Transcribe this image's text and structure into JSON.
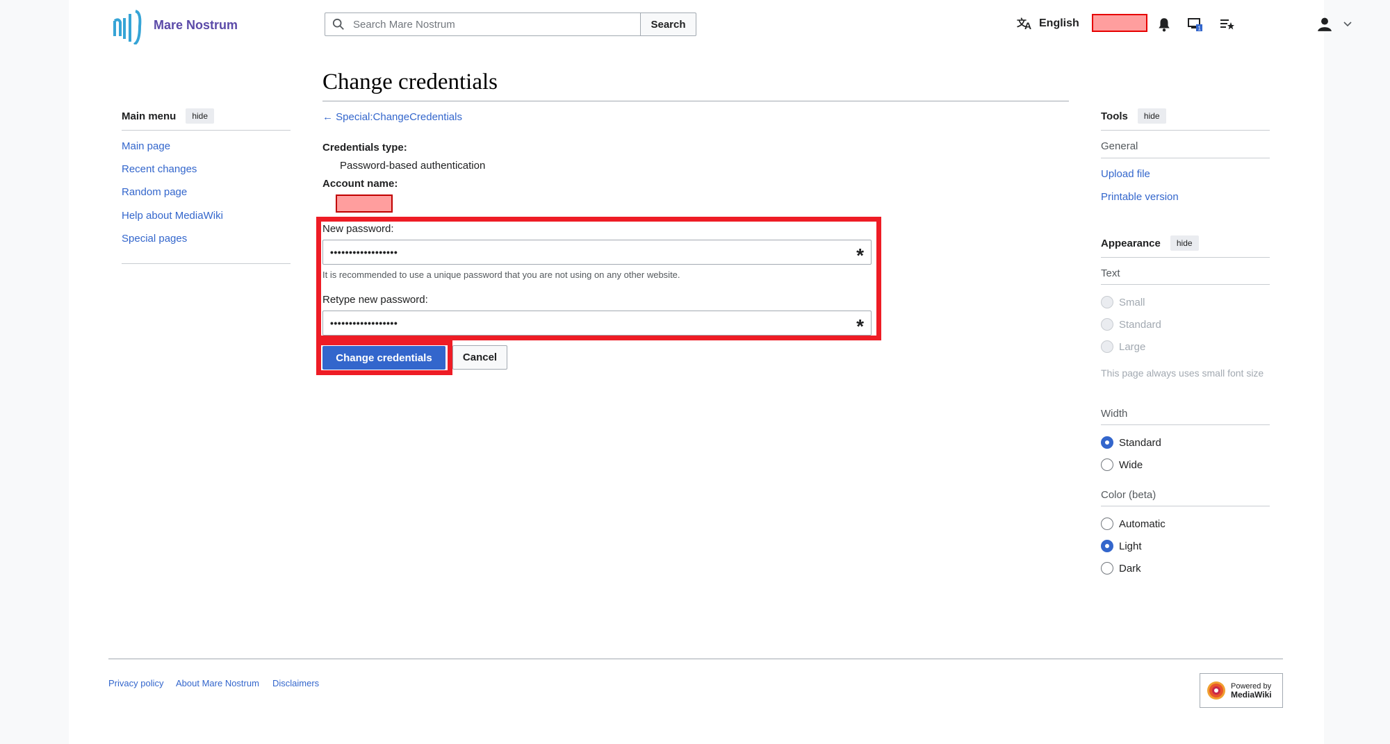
{
  "header": {
    "site_name": "Mare Nostrum",
    "search_placeholder": "Search Mare Nostrum",
    "search_button": "Search",
    "language": "English"
  },
  "main_menu": {
    "title": "Main menu",
    "hide_label": "hide",
    "items": [
      "Main page",
      "Recent changes",
      "Random page",
      "Help about MediaWiki",
      "Special pages"
    ]
  },
  "content": {
    "title": "Change credentials",
    "back_link": "← Special:ChangeCredentials",
    "credentials_type_label": "Credentials type:",
    "credentials_type_value": "Password-based authentication",
    "account_name_label": "Account name:",
    "new_password_label": "New password:",
    "new_password_value": "••••••••••••••••••",
    "password_hint": "It is recommended to use a unique password that you are not using on any other website.",
    "retype_password_label": "Retype new password:",
    "retype_password_value": "••••••••••••••••••",
    "required_mark": "*",
    "submit_label": "Change credentials",
    "cancel_label": "Cancel"
  },
  "tools": {
    "title": "Tools",
    "hide_label": "hide",
    "general_label": "General",
    "items": [
      "Upload file",
      "Printable version"
    ]
  },
  "appearance": {
    "title": "Appearance",
    "hide_label": "hide",
    "text_label": "Text",
    "text_options": [
      "Small",
      "Standard",
      "Large"
    ],
    "text_note": "This page always uses small font size",
    "width_label": "Width",
    "width_options": [
      "Standard",
      "Wide"
    ],
    "width_selected": "Standard",
    "color_label": "Color (beta)",
    "color_options": [
      "Automatic",
      "Light",
      "Dark"
    ],
    "color_selected": "Light"
  },
  "footer": {
    "links": [
      "Privacy policy",
      "About Mare Nostrum",
      "Disclaimers"
    ],
    "powered_line1": "Powered by",
    "powered_line2": "MediaWiki"
  },
  "colors": {
    "link": "#3366cc",
    "primary_button": "#3366cc",
    "highlight": "#ee1c25",
    "redaction": "#ff9e9e"
  }
}
